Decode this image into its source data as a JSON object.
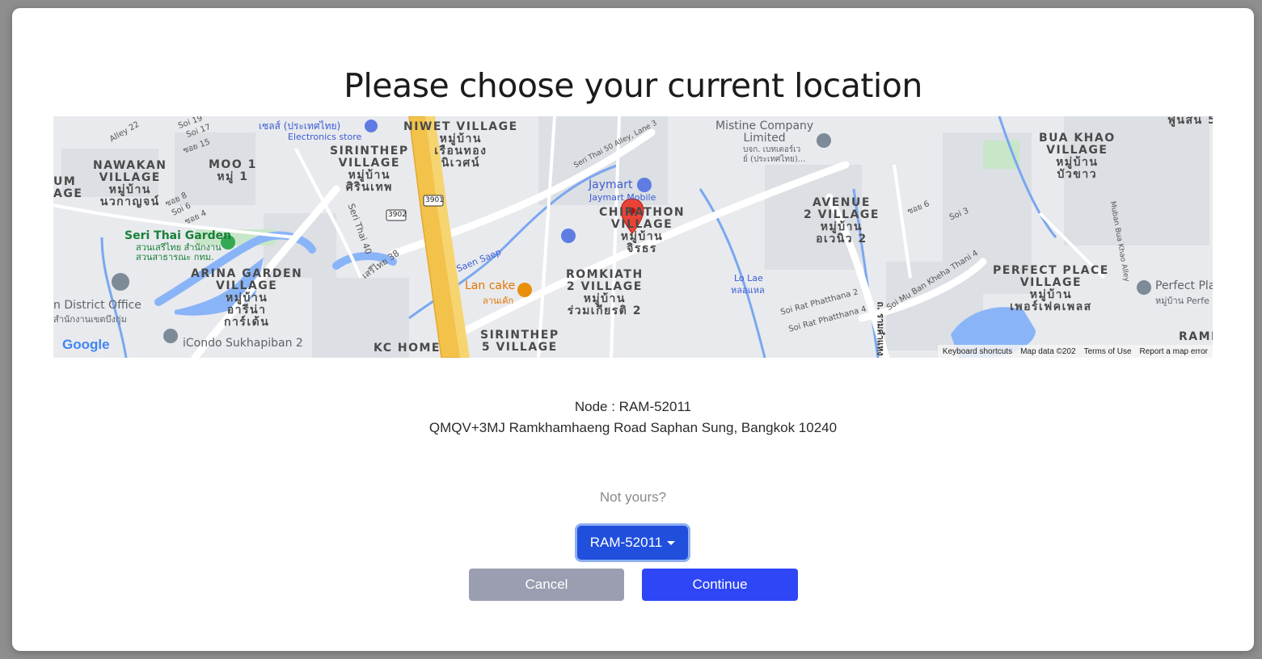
{
  "dialog": {
    "title": "Please choose your current location"
  },
  "map": {
    "area_labels": [
      "NAWAKAN\nVILLAGE\nหมู่บ้าน\nนวกาญจน์",
      "MOO 1\nหมู่ 1",
      "SIRINTHEP\nVILLAGE\nหมู่บ้าน\nศิรินเทพ",
      "NIWET VILLAGE\nหมู่บ้าน\nเรือนทอง\nนิเวศน์",
      "ARINA GARDEN\nVILLAGE\nหมู่บ้าน\nอารีน่า\nการ์เด้น",
      "CHIRATHON\nVILLAGE\nหมู่บ้าน\nจิรธร",
      "ROMKIATH\n2 VILLAGE\nหมู่บ้าน\nร่วมเกียรติ 2",
      "SIRINTHEP\n5 VILLAGE",
      "KC HOME",
      "AVENUE\n2 VILLAGE\nหมู่บ้าน\nอเวนิว 2",
      "BUA KHAO\nVILLAGE\nหมู่บ้าน\nบัวขาว",
      "PERFECT PLACE\nVILLAGE\nหมู่บ้าน\nเพอร์เฟคเพลส",
      "UM\nAGE",
      "RAMKH"
    ],
    "poi_labels": {
      "seri_thai_garden": "Seri Thai Garden",
      "seri_thai_garden_th": "สวนเสรีไทย สำนักงาน\nสวนสาธารณะ กทม.",
      "jaymart": "Jaymart",
      "jaymart_sub": "Jaymart Mobile",
      "mistine": "Mistine Company\nLimited",
      "mistine_th": "บจก. เบทเตอร์เว\nย์ (ประเทศไทย)...",
      "lan_cake": "Lan cake",
      "lan_cake_th": "ลานเค้ก",
      "district_office": "n District Office",
      "district_office_th": "สำนักงานเขตบึงกุ่ม",
      "icondo": "iCondo Sukhapiban 2",
      "electronics": "เซลส์ (ประเทศไทย)",
      "electronics_sub": "Electronics store",
      "lo_lae": "Lo Lae",
      "lo_lae_th": "หลอแหล",
      "perfect_pl": "Perfect Pla",
      "perfect_pl_th": "หมู่บ้าน Perfe"
    },
    "road_labels": {
      "r3901": "3901",
      "r3902": "3902",
      "saen_saep": "Saen Saep",
      "soi_thai_50": "Seri Thai 50 Alley, Lane 3",
      "seri_thai_40": "Seri Thai 40",
      "seri_thai_38": "เสรีไทย 38",
      "soi_rat_2": "Soi Rat Phatthana 2",
      "soi_rat_4": "Soi Rat Phatthana 4",
      "soi_mu_ban": "Soi Mu Ban Kheha Thani 4",
      "soi_6": "ซอย 6",
      "soi_3": "Soi 3",
      "alley_22": "Alley 22",
      "soi_17": "Soi 17",
      "soi_15": "ซอย 15",
      "soi_8": "ซอย 8",
      "soi_6b": "Soi 6",
      "soi_4": "ซอย 4",
      "soi_19": "Soi 19",
      "muban_bua": "Muban Bua Khao Alley",
      "ramkhamhaeng_th": "ถ. รามคำแหง"
    },
    "google_logo": "Google",
    "footer": {
      "shortcuts": "Keyboard shortcuts",
      "map_data": "Map data ©202",
      "terms": "Terms of Use",
      "report": "Report a map error"
    },
    "top_right_label": "ฟูนสน 5"
  },
  "node": {
    "line": "Node : RAM-52011",
    "address": "QMQV+3MJ Ramkhamhaeng Road Saphan Sung, Bangkok 10240"
  },
  "not_yours": "Not yours?",
  "node_select": {
    "value": "RAM-52011"
  },
  "buttons": {
    "cancel": "Cancel",
    "continue": "Continue"
  },
  "colors": {
    "primary": "#2e46f5",
    "dropdown": "#1f4fdc",
    "cancel": "#9a9eb0",
    "highway": "#f3c24a",
    "water": "#8ab4f8",
    "park": "#c8e6c9",
    "marker": "#ea4335"
  }
}
